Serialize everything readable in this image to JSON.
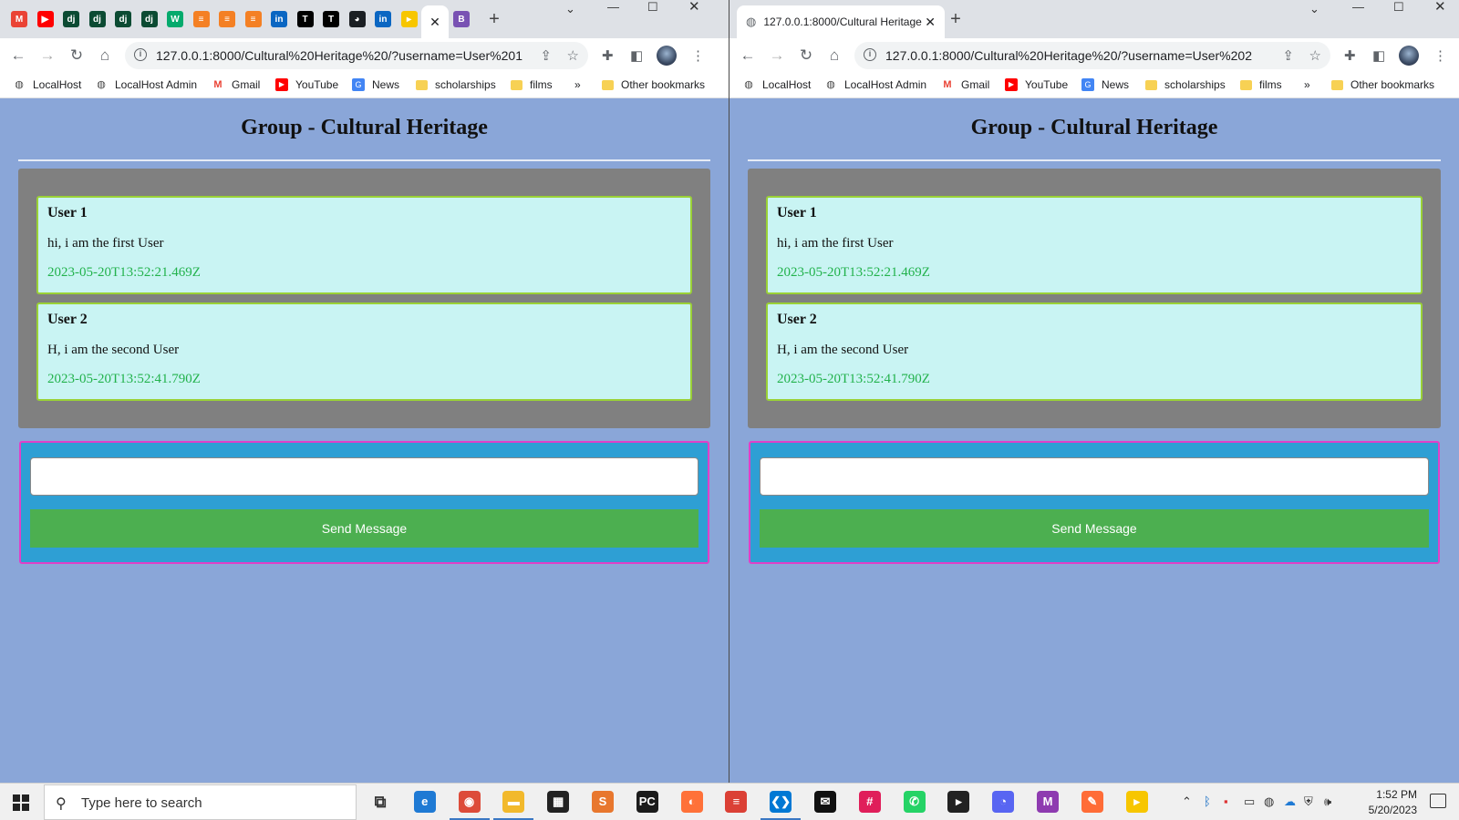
{
  "left_window": {
    "tabs": [
      {
        "icon": "gmail-icon",
        "glyph": "M",
        "color": "#ea4335"
      },
      {
        "icon": "youtube-icon",
        "glyph": "▶",
        "color": "#ff0000"
      },
      {
        "icon": "django-icon",
        "glyph": "dj",
        "color": "#0c4b33"
      },
      {
        "icon": "django-icon",
        "glyph": "dj",
        "color": "#0c4b33"
      },
      {
        "icon": "django-icon",
        "glyph": "dj",
        "color": "#0c4b33"
      },
      {
        "icon": "django-icon",
        "glyph": "dj",
        "color": "#0c4b33"
      },
      {
        "icon": "w3schools-icon",
        "glyph": "W",
        "color": "#04aa6d"
      },
      {
        "icon": "stackoverflow-icon",
        "glyph": "≡",
        "color": "#f48024"
      },
      {
        "icon": "stackoverflow-icon",
        "glyph": "≡",
        "color": "#f48024"
      },
      {
        "icon": "stackoverflow-icon",
        "glyph": "≡",
        "color": "#f48024"
      },
      {
        "icon": "linkedin-icon",
        "glyph": "in",
        "color": "#0a66c2"
      },
      {
        "icon": "medium-icon",
        "glyph": "T",
        "color": "#000000"
      },
      {
        "icon": "medium-icon",
        "glyph": "T",
        "color": "#000000"
      },
      {
        "icon": "github-icon",
        "glyph": "◕",
        "color": "#1b1f23"
      },
      {
        "icon": "linkedin-icon",
        "glyph": "in",
        "color": "#0a66c2"
      },
      {
        "icon": "sticky-icon",
        "glyph": "▸",
        "color": "#f7c600"
      },
      {
        "icon": "bootstrap-icon",
        "glyph": "B",
        "color": "#7952b3"
      }
    ],
    "url": "127.0.0.1:8000/Cultural%20Heritage%20/?username=User%201"
  },
  "right_window": {
    "tab_title": "127.0.0.1:8000/Cultural Heritage",
    "url": "127.0.0.1:8000/Cultural%20Heritage%20/?username=User%202"
  },
  "bookmarks": [
    {
      "label": "LocalHost",
      "icon": "globe-icon"
    },
    {
      "label": "LocalHost Admin",
      "icon": "globe-icon"
    },
    {
      "label": "Gmail",
      "icon": "gmail-icon"
    },
    {
      "label": "YouTube",
      "icon": "youtube-icon"
    },
    {
      "label": "News",
      "icon": "news-icon"
    },
    {
      "label": "scholarships",
      "icon": "folder-icon"
    },
    {
      "label": "films",
      "icon": "folder-icon"
    }
  ],
  "bookmarks_overflow": "»",
  "other_bookmarks": "Other bookmarks",
  "page": {
    "title": "Group - Cultural Heritage",
    "messages": [
      {
        "user": "User 1",
        "text": "hi, i am the first User",
        "timestamp": "2023-05-20T13:52:21.469Z"
      },
      {
        "user": "User 2",
        "text": "H, i am the second User",
        "timestamp": "2023-05-20T13:52:41.790Z"
      }
    ],
    "input_value": "",
    "send_label": "Send Message",
    "colors": {
      "background": "#8aa6d8",
      "chat_panel": "#808080",
      "message_bg": "#c9f4f3",
      "message_border": "#9ad136",
      "timestamp": "#22b24c",
      "form_bg": "#2e9fd4",
      "form_border": "#e040c8",
      "send_button": "#4caf50"
    }
  },
  "taskbar": {
    "search_placeholder": "Type here to search",
    "time": "1:52 PM",
    "date": "5/20/2023",
    "apps": [
      {
        "name": "task-view-icon",
        "glyph": "⧉",
        "color": "#333333"
      },
      {
        "name": "edge-icon",
        "glyph": "e",
        "color": "#1f7ad4"
      },
      {
        "name": "chrome-icon",
        "glyph": "◉",
        "color": "#dd4b39",
        "active": true
      },
      {
        "name": "file-explorer-icon",
        "glyph": "▬",
        "color": "#f2b92c",
        "active": true
      },
      {
        "name": "store-icon",
        "glyph": "▦",
        "color": "#222222"
      },
      {
        "name": "sublime-icon",
        "glyph": "S",
        "color": "#e8772e"
      },
      {
        "name": "pycharm-icon",
        "glyph": "PC",
        "color": "#1b1b1b"
      },
      {
        "name": "firefox-icon",
        "glyph": "◐",
        "color": "#ff7139"
      },
      {
        "name": "todoist-icon",
        "glyph": "≡",
        "color": "#db4035"
      },
      {
        "name": "vscode-icon",
        "glyph": "❮❯",
        "color": "#0078d4",
        "active": true
      },
      {
        "name": "mail-icon",
        "glyph": "✉",
        "color": "#111111"
      },
      {
        "name": "slack-icon",
        "glyph": "#",
        "color": "#e01e5a"
      },
      {
        "name": "whatsapp-icon",
        "glyph": "✆",
        "color": "#25d366"
      },
      {
        "name": "sticky-icon",
        "glyph": "▸",
        "color": "#222222"
      },
      {
        "name": "discord-icon",
        "glyph": "◔",
        "color": "#5865f2"
      },
      {
        "name": "m-app-icon",
        "glyph": "M",
        "color": "#8e3bb0"
      },
      {
        "name": "postman-icon",
        "glyph": "✎",
        "color": "#ff6c37"
      },
      {
        "name": "stickies-icon",
        "glyph": "▸",
        "color": "#f7c600"
      }
    ]
  }
}
